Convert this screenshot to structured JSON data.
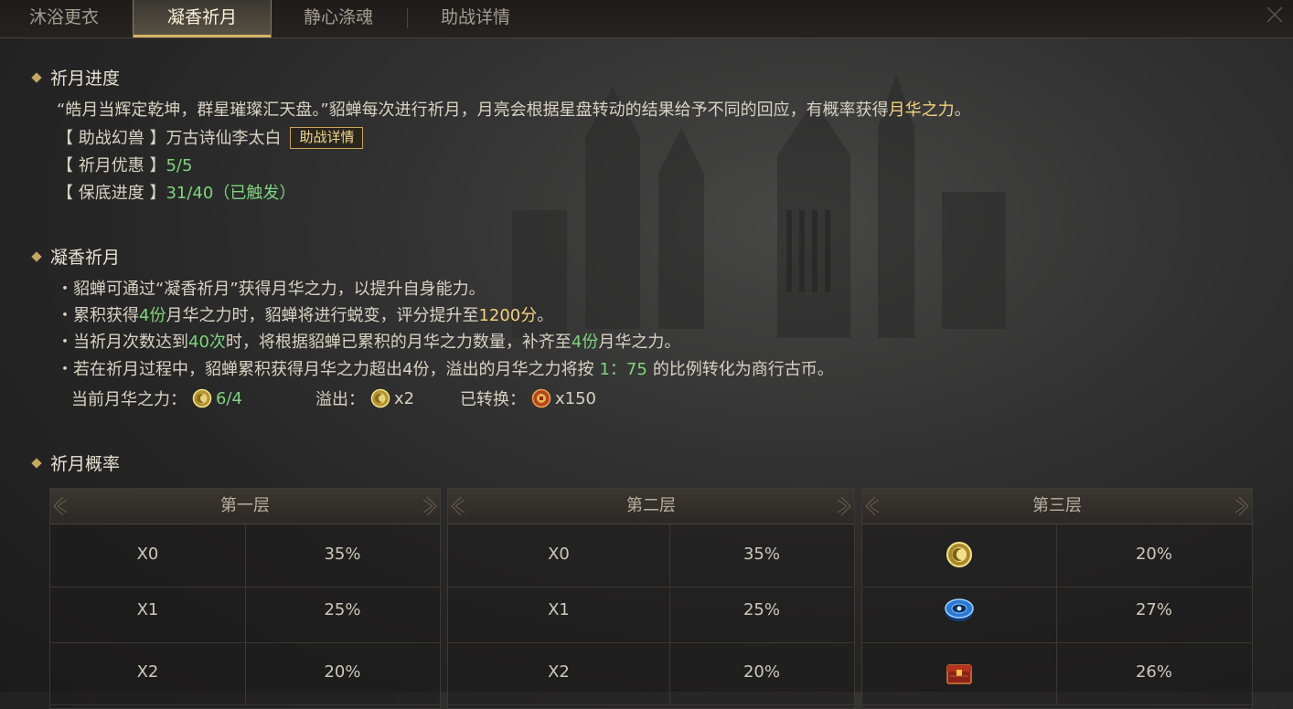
{
  "tabs": [
    {
      "label": "沐浴更衣"
    },
    {
      "label": "凝香祈月"
    },
    {
      "label": "静心涤魂"
    },
    {
      "label": "助战详情"
    }
  ],
  "active_tab_index": 1,
  "progress_section": {
    "title": "祈月进度",
    "intro_prefix": "“皓月当辉定乾坤，群星璀璨汇天盘。”貂蝉每次进行祈月，月亮会根据星盘转动的结果给予不同的回应，有概率获得",
    "intro_highlight": "月华之力",
    "intro_suffix": "。",
    "assist_label": "【 助战幻兽 】万古诗仙李太白",
    "assist_button": "助战详情",
    "discount_label": "【 祈月优惠 】",
    "discount_value": "5/5",
    "pity_label": "【 保底进度 】",
    "pity_value": "31/40（已触发）"
  },
  "rules_section": {
    "title": "凝香祈月",
    "line1": "・貂蝉可通过“凝香祈月”获得月华之力，以提升自身能力。",
    "line2_a": "・累积获得",
    "line2_b": "4份",
    "line2_c": "月华之力时，貂蝉将进行蜕变，评分提升至",
    "line2_d": "1200分",
    "line2_e": "。",
    "line3_a": "・当祈月次数达到",
    "line3_b": "40次",
    "line3_c": "时，将根据貂蝉已累积的月华之力数量，补齐至",
    "line3_d": "4份",
    "line3_e": "月华之力。",
    "line4_a": "・若在祈月过程中，貂蝉累积获得月华之力超出4份，溢出的月华之力将按",
    "line4_b": "1：75",
    "line4_c": "的比例转化为商行古币。",
    "current_label": "当前月华之力：",
    "current_value": "6/4",
    "overflow_label": "溢出：",
    "overflow_value": "x2",
    "converted_label": "已转换：",
    "converted_value": "x150"
  },
  "rate_section": {
    "title": "祈月概率",
    "tables": [
      {
        "title": "第一层",
        "rows": [
          {
            "item": "X0",
            "rate": "35%"
          },
          {
            "item": "X1",
            "rate": "25%"
          },
          {
            "item": "X2",
            "rate": "20%"
          }
        ]
      },
      {
        "title": "第二层",
        "rows": [
          {
            "item": "X0",
            "rate": "35%"
          },
          {
            "item": "X1",
            "rate": "25%"
          },
          {
            "item": "X2",
            "rate": "20%"
          }
        ]
      },
      {
        "title": "第三层",
        "rows": [
          {
            "icon": "moon-essence-icon",
            "rate": "20%"
          },
          {
            "icon": "blue-disc-icon",
            "rate": "27%"
          },
          {
            "icon": "red-chest-icon",
            "rate": "26%"
          }
        ]
      }
    ]
  },
  "colors": {
    "accent_gold": "#f3d27a",
    "highlight_green": "#7fd47e",
    "tab_underline": "#d4b56a"
  }
}
